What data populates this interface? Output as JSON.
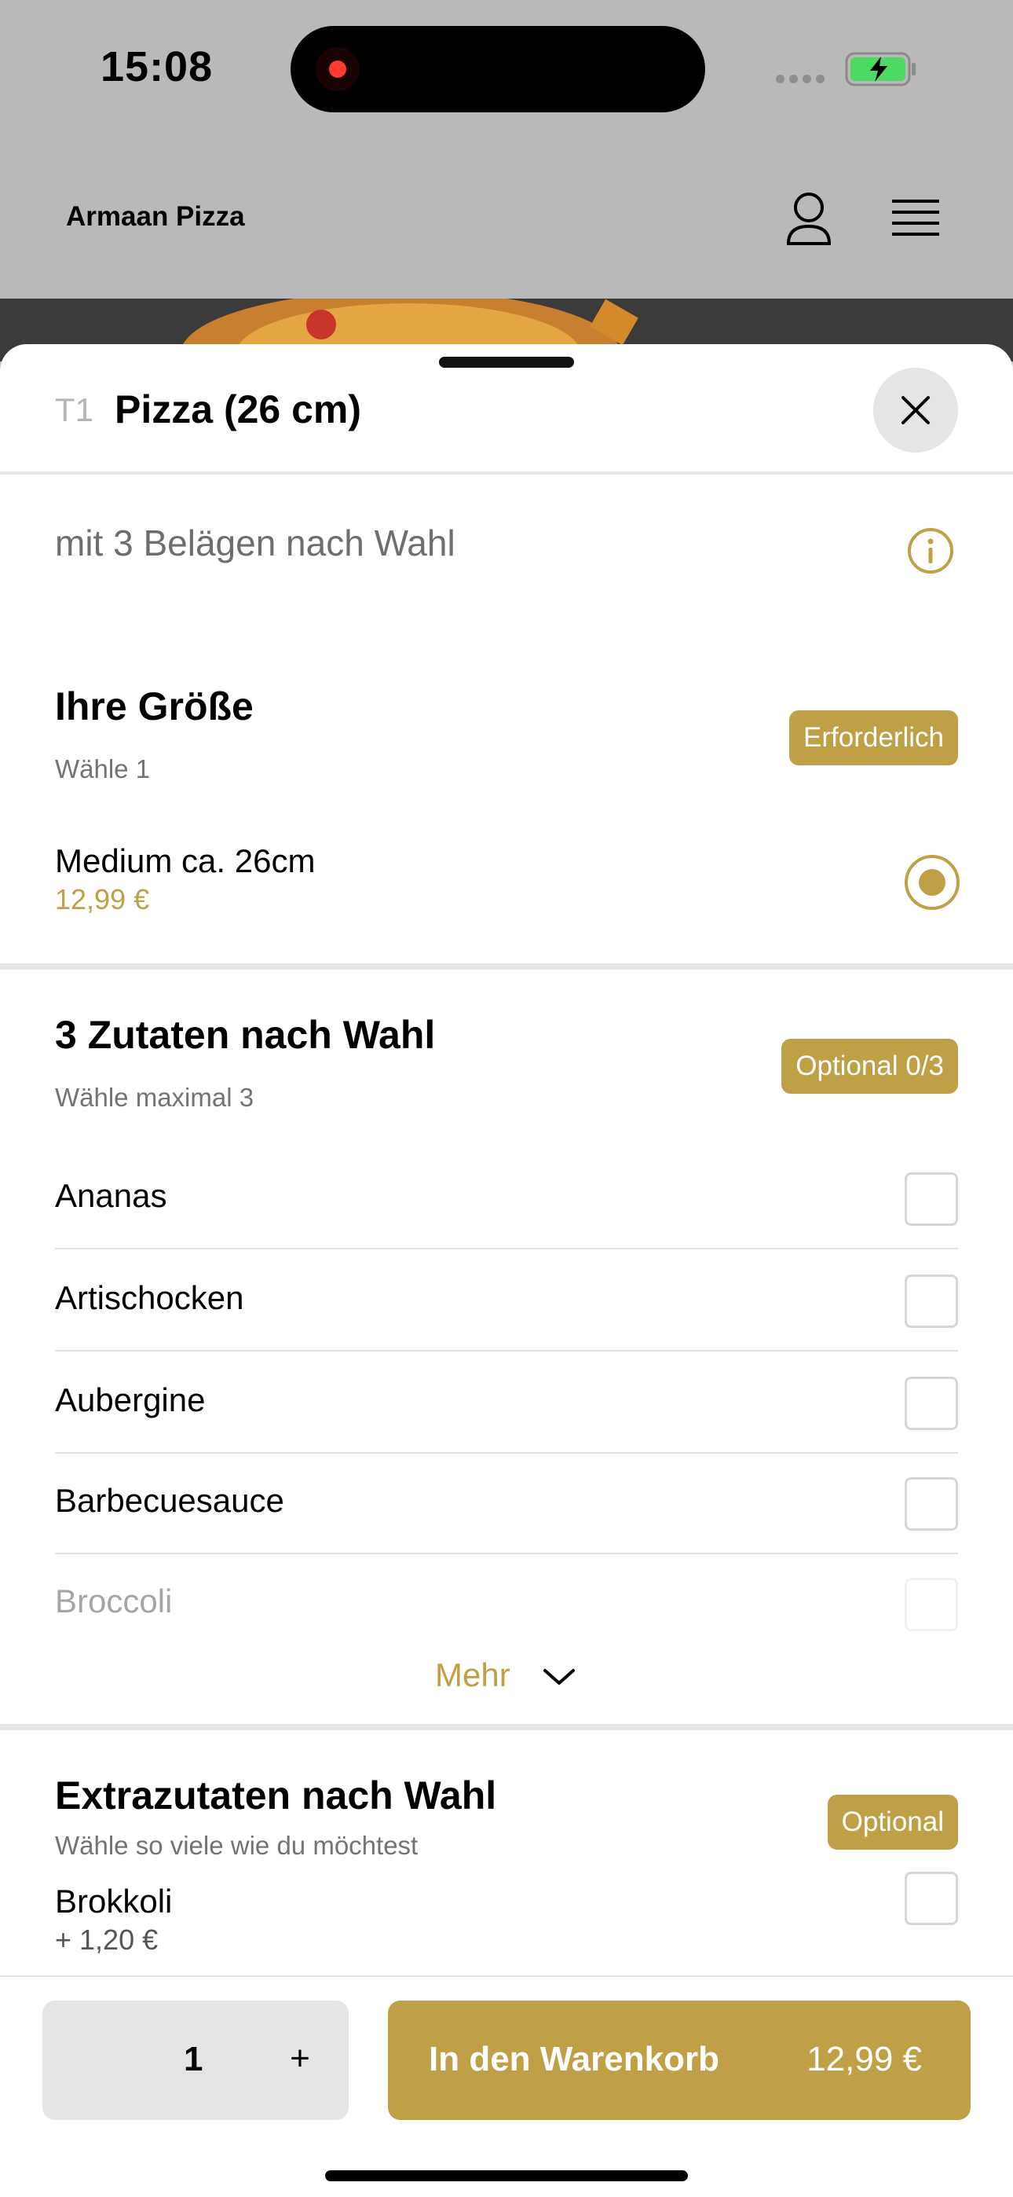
{
  "status_bar": {
    "time": "15:08"
  },
  "header": {
    "brand": "Armaan Pizza"
  },
  "sheet": {
    "item_code": "T1",
    "title": "Pizza (26 cm)",
    "description": "mit 3 Belägen nach Wahl"
  },
  "size_group": {
    "title": "Ihre Größe",
    "subtitle": "Wähle 1",
    "badge": "Erforderlich",
    "option": {
      "label": "Medium ca. 26cm",
      "price": "12,99 €",
      "selected": true
    }
  },
  "toppings_group": {
    "title": "3 Zutaten nach Wahl",
    "subtitle": "Wähle maximal 3",
    "badge": "Optional 0/3",
    "items": [
      {
        "label": "Ananas"
      },
      {
        "label": "Artischocken"
      },
      {
        "label": "Aubergine"
      },
      {
        "label": "Barbecuesauce"
      },
      {
        "label": "Broccoli"
      }
    ],
    "more_label": "Mehr"
  },
  "extras_group": {
    "title": "Extrazutaten nach Wahl",
    "subtitle": "Wähle so viele wie du möchtest",
    "badge": "Optional",
    "items": [
      {
        "label": "Brokkoli",
        "price": "+ 1,20 €"
      }
    ]
  },
  "bottom_bar": {
    "quantity": "1",
    "plus_label": "+",
    "cart_label": "In den Warenkorb",
    "cart_price": "12,99 €"
  },
  "colors": {
    "accent": "#bfa046",
    "overlay": "#b9b9b9",
    "battery_green": "#4cd964"
  },
  "icons": [
    "record-icon",
    "signal-icon",
    "battery-icon",
    "user-icon",
    "menu-icon",
    "close-icon",
    "info-icon",
    "chevron-down-icon"
  ]
}
